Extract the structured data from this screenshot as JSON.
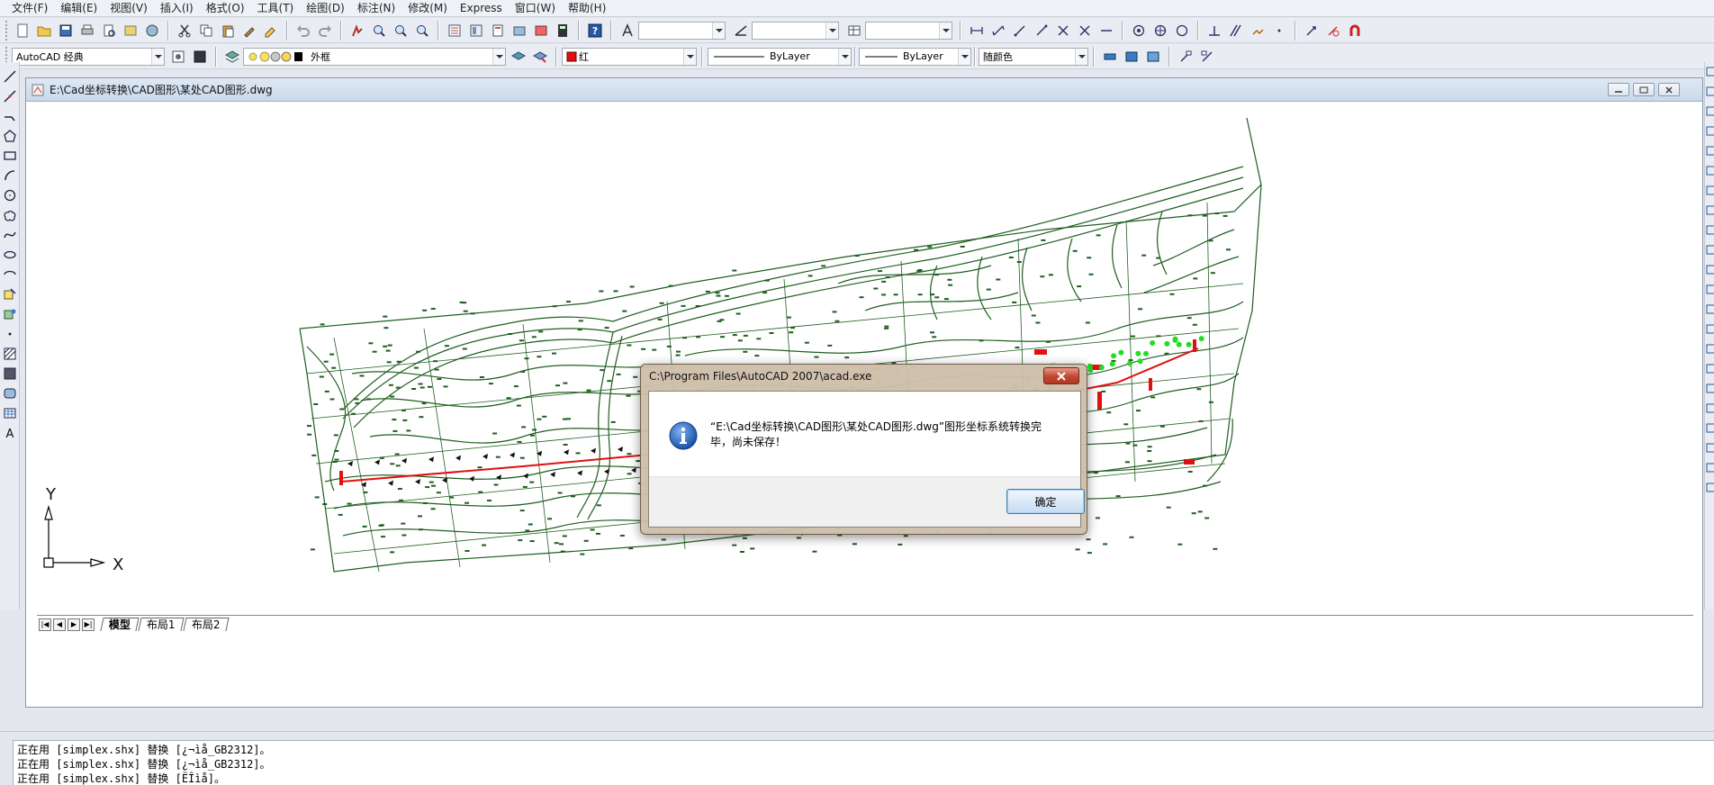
{
  "menu": [
    "文件(F)",
    "编辑(E)",
    "视图(V)",
    "插入(I)",
    "格式(O)",
    "工具(T)",
    "绘图(D)",
    "标注(N)",
    "修改(M)",
    "Express",
    "窗口(W)",
    "帮助(H)"
  ],
  "toolbar2": {
    "workspace": "AutoCAD 经典",
    "layer": "外框",
    "color": "红",
    "linetype": "ByLayer",
    "lineweight": "ByLayer",
    "plotstyle": "随颜色"
  },
  "document": {
    "title": "E:\\Cad坐标转换\\CAD图形\\某处CAD图形.dwg"
  },
  "ucs": {
    "x_label": "X",
    "y_label": "Y"
  },
  "layout_tabs": [
    "模型",
    "布局1",
    "布局2"
  ],
  "dialog": {
    "title": "C:\\Program Files\\AutoCAD 2007\\acad.exe",
    "message_line1": "“E:\\Cad坐标转换\\CAD图形\\某处CAD图形.dwg”图形坐标系统转换完",
    "message_line2": "毕，尚未保存！",
    "ok_label": "确定"
  },
  "command_lines": [
    "正在用 [simplex.shx] 替换 [¿¬ìå_GB2312]。",
    "正在用 [simplex.shx] 替换 [¿¬ìå_GB2312]。",
    "正在用 [simplex.shx] 替换 [ËÎìå]。"
  ],
  "colors": {
    "map_lines": "#1f5e1f",
    "route_red": "#e01010",
    "route_green": "#22dd22",
    "accent_blue": "#3c7fb1"
  },
  "icons": {
    "dialog_icon": "info-icon",
    "close": "close-icon"
  }
}
